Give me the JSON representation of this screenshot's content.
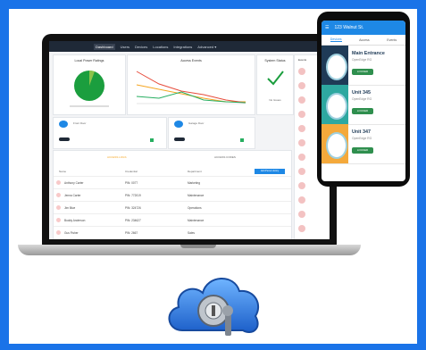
{
  "colors": {
    "frame": "#1a73e8",
    "accent": "#1e88e5",
    "locked": "#4caf50",
    "alert": "#f4a93b"
  },
  "dashboard": {
    "nav": [
      "Dashboard",
      "Users",
      "Devices",
      "Locations",
      "Integrations",
      "Advanced ▾"
    ],
    "card1_title": "Local Power Ratings",
    "card2_title": "Access Events",
    "card3_title": "System Status",
    "card3_status": "No Issues",
    "door1_title": "Front Door",
    "door2_title": "Garage Door",
    "tab1": "ACCESS LOGS",
    "tab2": "ACCESS CODES",
    "table_headers": [
      "Name",
      "Credential",
      "Department"
    ],
    "add_button": "Add Person Entry",
    "rows": [
      {
        "name": "Anthony Carter",
        "cred": "PIN: 0077",
        "dept": "Marketing"
      },
      {
        "name": "Jenna Carter",
        "cred": "PIN: 772019",
        "dept": "Maintenance"
      },
      {
        "name": "Jim Blue",
        "cred": "PIN: 324726",
        "dept": "Operations"
      },
      {
        "name": "Buddy Anderson",
        "cred": "PIN: 234627",
        "dept": "Maintenance"
      },
      {
        "name": "Gus Fisher",
        "cred": "PIN: 2667",
        "dept": "Sales"
      }
    ],
    "events_title": "Events"
  },
  "phone": {
    "header_title": "123 Walnut St.",
    "tabs": [
      "Devices",
      "Access",
      "Events"
    ],
    "units": [
      {
        "name": "Main Entrance",
        "sub": "OpenEdge RG",
        "status": "LOCKED",
        "color": "#2f8f4e"
      },
      {
        "name": "Unit 345",
        "sub": "OpenEdge RG",
        "status": "LOCKED",
        "color": "#2f8f4e"
      },
      {
        "name": "Unit 347",
        "sub": "OpenEdge RG",
        "status": "LOCKED",
        "color": "#2f8f4e"
      }
    ]
  }
}
